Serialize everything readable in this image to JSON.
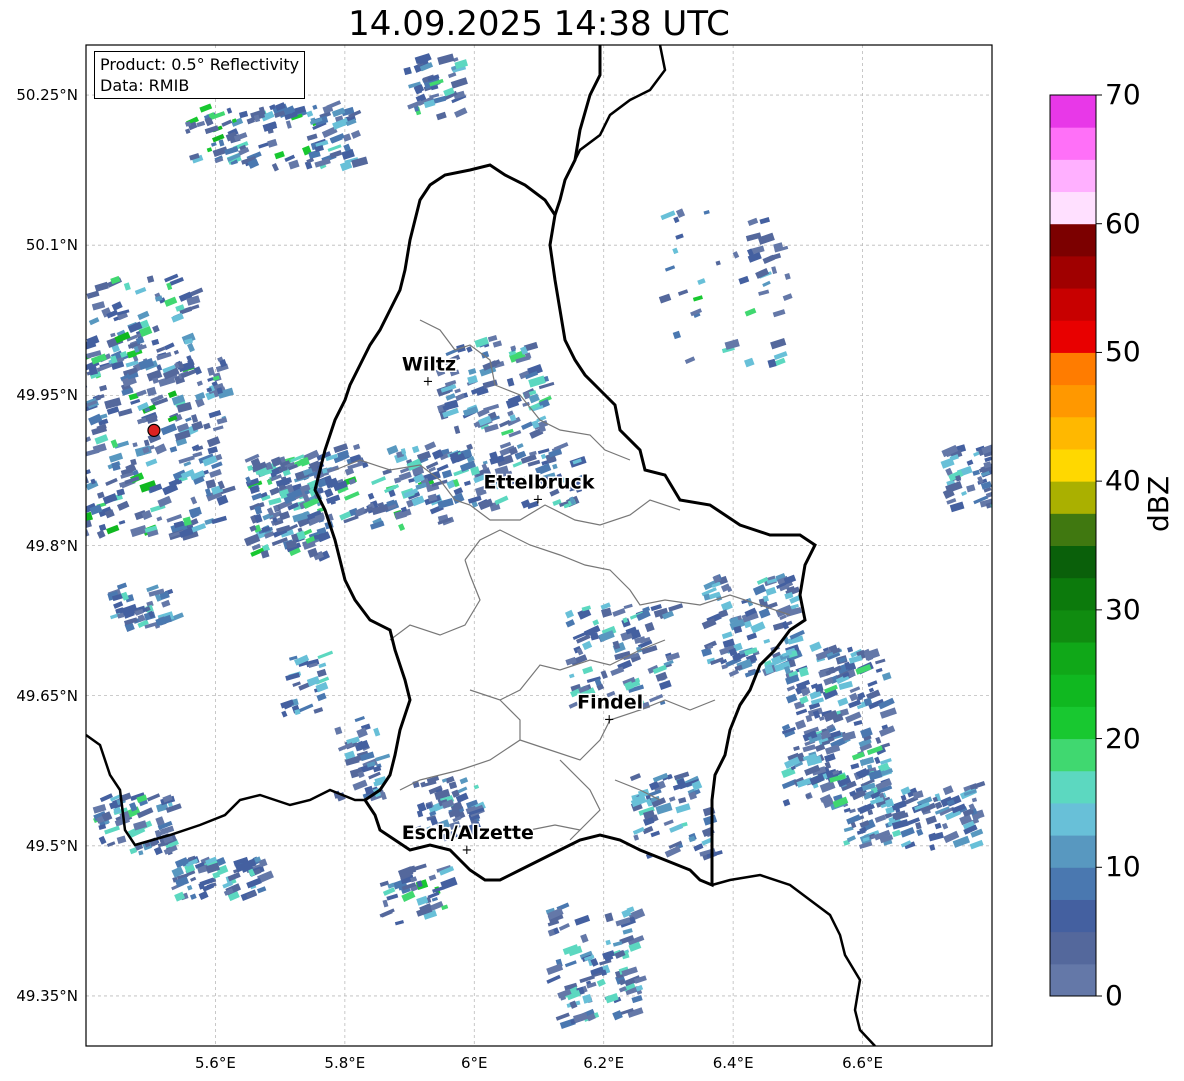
{
  "title": "14.09.2025 14:38 UTC",
  "info": {
    "product": "Product: 0.5° Reflectivity",
    "data": "Data: RMIB"
  },
  "axes": {
    "lon_range": [
      5.4,
      6.8
    ],
    "lat_range": [
      49.3,
      50.3
    ],
    "lon_ticks": [
      {
        "value": 5.6,
        "label": "5.6°E"
      },
      {
        "value": 5.8,
        "label": "5.8°E"
      },
      {
        "value": 6.0,
        "label": "6°E"
      },
      {
        "value": 6.2,
        "label": "6.2°E"
      },
      {
        "value": 6.4,
        "label": "6.4°E"
      },
      {
        "value": 6.6,
        "label": "6.6°E"
      }
    ],
    "lat_ticks": [
      {
        "value": 50.25,
        "label": "50.25°N"
      },
      {
        "value": 50.1,
        "label": "50.1°N"
      },
      {
        "value": 49.95,
        "label": "49.95°N"
      },
      {
        "value": 49.8,
        "label": "49.8°N"
      },
      {
        "value": 49.65,
        "label": "49.65°N"
      },
      {
        "value": 49.5,
        "label": "49.5°N"
      },
      {
        "value": 49.35,
        "label": "49.35°N"
      }
    ]
  },
  "cities": [
    {
      "name": "Wiltz",
      "lon": 5.93,
      "lat": 49.965
    },
    {
      "name": "Ettelbruck",
      "lon": 6.1,
      "lat": 49.847
    },
    {
      "name": "Findel",
      "lon": 6.21,
      "lat": 49.627
    },
    {
      "name": "Esch/Alzette",
      "lon": 5.99,
      "lat": 49.497
    }
  ],
  "radar_site": {
    "lon": 5.505,
    "lat": 49.915,
    "color": "#dd2222"
  },
  "colorbar": {
    "label": "dBZ",
    "min": 0,
    "max": 70,
    "ticks": [
      {
        "value": 0,
        "label": "0"
      },
      {
        "value": 10,
        "label": "10"
      },
      {
        "value": 20,
        "label": "20"
      },
      {
        "value": 30,
        "label": "30"
      },
      {
        "value": 40,
        "label": "40"
      },
      {
        "value": 50,
        "label": "50"
      },
      {
        "value": 60,
        "label": "60"
      },
      {
        "value": 70,
        "label": "70"
      }
    ],
    "colors": [
      "#6478a8",
      "#54689c",
      "#4460a0",
      "#4a78b0",
      "#5898c0",
      "#68c0d8",
      "#5cd8c0",
      "#40d870",
      "#18c830",
      "#10b820",
      "#10a818",
      "#108c10",
      "#0c7a0c",
      "#0a600a",
      "#407810",
      "#aab000",
      "#ffd800",
      "#ffb800",
      "#ff9800",
      "#ff7c00",
      "#e80000",
      "#c80000",
      "#a00000",
      "#7c0000",
      "#ffe0ff",
      "#ffb0ff",
      "#ff70f8",
      "#e838e8"
    ]
  },
  "echo_clusters": [
    {
      "lon": 5.5,
      "lat": 49.91,
      "rlon": 0.11,
      "rlat": 0.1,
      "n": 220,
      "dbz_max": 25
    },
    {
      "lon": 5.68,
      "lat": 50.21,
      "rlon": 0.13,
      "rlat": 0.03,
      "n": 110,
      "dbz_max": 25
    },
    {
      "lon": 5.7,
      "lat": 49.84,
      "rlon": 0.06,
      "rlat": 0.05,
      "n": 140,
      "dbz_max": 22
    },
    {
      "lon": 5.86,
      "lat": 49.86,
      "rlon": 0.1,
      "rlat": 0.04,
      "n": 100,
      "dbz_max": 22
    },
    {
      "lon": 6.02,
      "lat": 49.96,
      "rlon": 0.08,
      "rlat": 0.05,
      "n": 90,
      "dbz_max": 20
    },
    {
      "lon": 6.06,
      "lat": 49.87,
      "rlon": 0.1,
      "rlat": 0.03,
      "n": 80,
      "dbz_max": 18
    },
    {
      "lon": 6.22,
      "lat": 49.69,
      "rlon": 0.08,
      "rlat": 0.05,
      "n": 80,
      "dbz_max": 16
    },
    {
      "lon": 6.42,
      "lat": 49.72,
      "rlon": 0.07,
      "rlat": 0.05,
      "n": 100,
      "dbz_max": 14
    },
    {
      "lon": 6.55,
      "lat": 49.62,
      "rlon": 0.08,
      "rlat": 0.08,
      "n": 200,
      "dbz_max": 18
    },
    {
      "lon": 6.67,
      "lat": 49.53,
      "rlon": 0.1,
      "rlat": 0.03,
      "n": 100,
      "dbz_max": 14
    },
    {
      "lon": 6.3,
      "lat": 49.53,
      "rlon": 0.06,
      "rlat": 0.04,
      "n": 60,
      "dbz_max": 14
    },
    {
      "lon": 6.76,
      "lat": 49.87,
      "rlon": 0.04,
      "rlat": 0.03,
      "n": 45,
      "dbz_max": 12
    },
    {
      "lon": 6.18,
      "lat": 49.38,
      "rlon": 0.07,
      "rlat": 0.06,
      "n": 90,
      "dbz_max": 16
    },
    {
      "lon": 5.48,
      "lat": 50.02,
      "rlon": 0.08,
      "rlat": 0.05,
      "n": 70,
      "dbz_max": 25
    },
    {
      "lon": 5.48,
      "lat": 49.74,
      "rlon": 0.05,
      "rlat": 0.02,
      "n": 40,
      "dbz_max": 16
    },
    {
      "lon": 5.47,
      "lat": 49.52,
      "rlon": 0.06,
      "rlat": 0.03,
      "n": 60,
      "dbz_max": 18
    },
    {
      "lon": 5.6,
      "lat": 49.47,
      "rlon": 0.07,
      "rlat": 0.02,
      "n": 60,
      "dbz_max": 16
    },
    {
      "lon": 5.9,
      "lat": 49.45,
      "rlon": 0.05,
      "rlat": 0.03,
      "n": 40,
      "dbz_max": 25
    },
    {
      "lon": 5.95,
      "lat": 49.54,
      "rlon": 0.05,
      "rlat": 0.03,
      "n": 50,
      "dbz_max": 16
    },
    {
      "lon": 5.93,
      "lat": 50.26,
      "rlon": 0.04,
      "rlat": 0.03,
      "n": 40,
      "dbz_max": 22
    },
    {
      "lon": 6.38,
      "lat": 50.06,
      "rlon": 0.1,
      "rlat": 0.08,
      "n": 45,
      "dbz_max": 22
    },
    {
      "lon": 5.82,
      "lat": 49.59,
      "rlon": 0.04,
      "rlat": 0.04,
      "n": 35,
      "dbz_max": 14
    },
    {
      "lon": 5.73,
      "lat": 49.66,
      "rlon": 0.03,
      "rlat": 0.03,
      "n": 25,
      "dbz_max": 12
    }
  ]
}
